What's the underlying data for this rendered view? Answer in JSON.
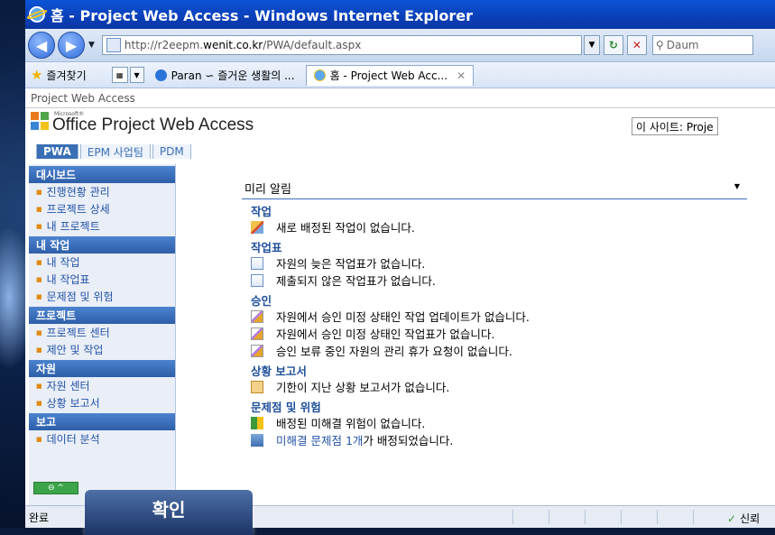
{
  "window": {
    "title": "홈 - Project Web Access - Windows Internet Explorer"
  },
  "address": {
    "url_prefix": "http://r2eepm.",
    "url_host": "wenit.co.kr",
    "url_suffix": "/PWA/default.aspx",
    "search_placeholder": "Daum"
  },
  "favorites": {
    "label": "즐겨찾기",
    "tabs": [
      {
        "label": "Paran ∽ 즐거운 생활의 ...",
        "active": false
      },
      {
        "label": "홈 - Project Web Acc...",
        "active": true
      }
    ]
  },
  "breadcrumb": "Project Web Access",
  "brand": {
    "small": "Microsoft®",
    "title": "Office Project Web Access",
    "site_search": "이 사이트: Proje"
  },
  "top_tabs": [
    {
      "label": "PWA",
      "active": true
    },
    {
      "label": "EPM 사업팀",
      "active": false
    },
    {
      "label": "PDM",
      "active": false
    }
  ],
  "left_nav": {
    "sections": [
      {
        "header": "대시보드",
        "items": [
          "진행현황 관리",
          "프로젝트 상세",
          "내 프로젝트"
        ]
      },
      {
        "header": "내 작업",
        "items": [
          "내 작업",
          "내 작업표",
          "문제점 및 위험"
        ]
      },
      {
        "header": "프로젝트",
        "items": [
          "프로젝트 센터",
          "제안 및 작업"
        ]
      },
      {
        "header": "자원",
        "items": [
          "자원 센터",
          "상황 보고서"
        ]
      },
      {
        "header": "보고",
        "items": [
          "데이터 분석"
        ]
      }
    ]
  },
  "reminders": {
    "title": "미리 알림",
    "task": {
      "header": "작업",
      "lines": [
        "새로 배정된 작업이 없습니다."
      ]
    },
    "timesheet": {
      "header": "작업표",
      "lines": [
        "자원의 늦은 작업표가 없습니다.",
        "제출되지 않은 작업표가 없습니다."
      ]
    },
    "approval": {
      "header": "승인",
      "lines": [
        "자원에서 승인 미정 상태인 작업 업데이트가 없습니다.",
        "자원에서 승인 미정 상태인 작업표가 없습니다.",
        "승인 보류 중인 자원의 관리 휴가 요청이 없습니다."
      ]
    },
    "status": {
      "header": "상황 보고서",
      "lines": [
        "기한이 지난 상황 보고서가 없습니다."
      ]
    },
    "issues": {
      "header": "문제점 및 위험",
      "risk_line": "배정된 미해결 위험이 없습니다.",
      "issue_link": "미해결 문제점 1개",
      "issue_rest": "가 배정되었습니다."
    }
  },
  "status_bar": {
    "left": "완료",
    "right": "신뢰"
  },
  "overlay": {
    "label": "확인"
  }
}
